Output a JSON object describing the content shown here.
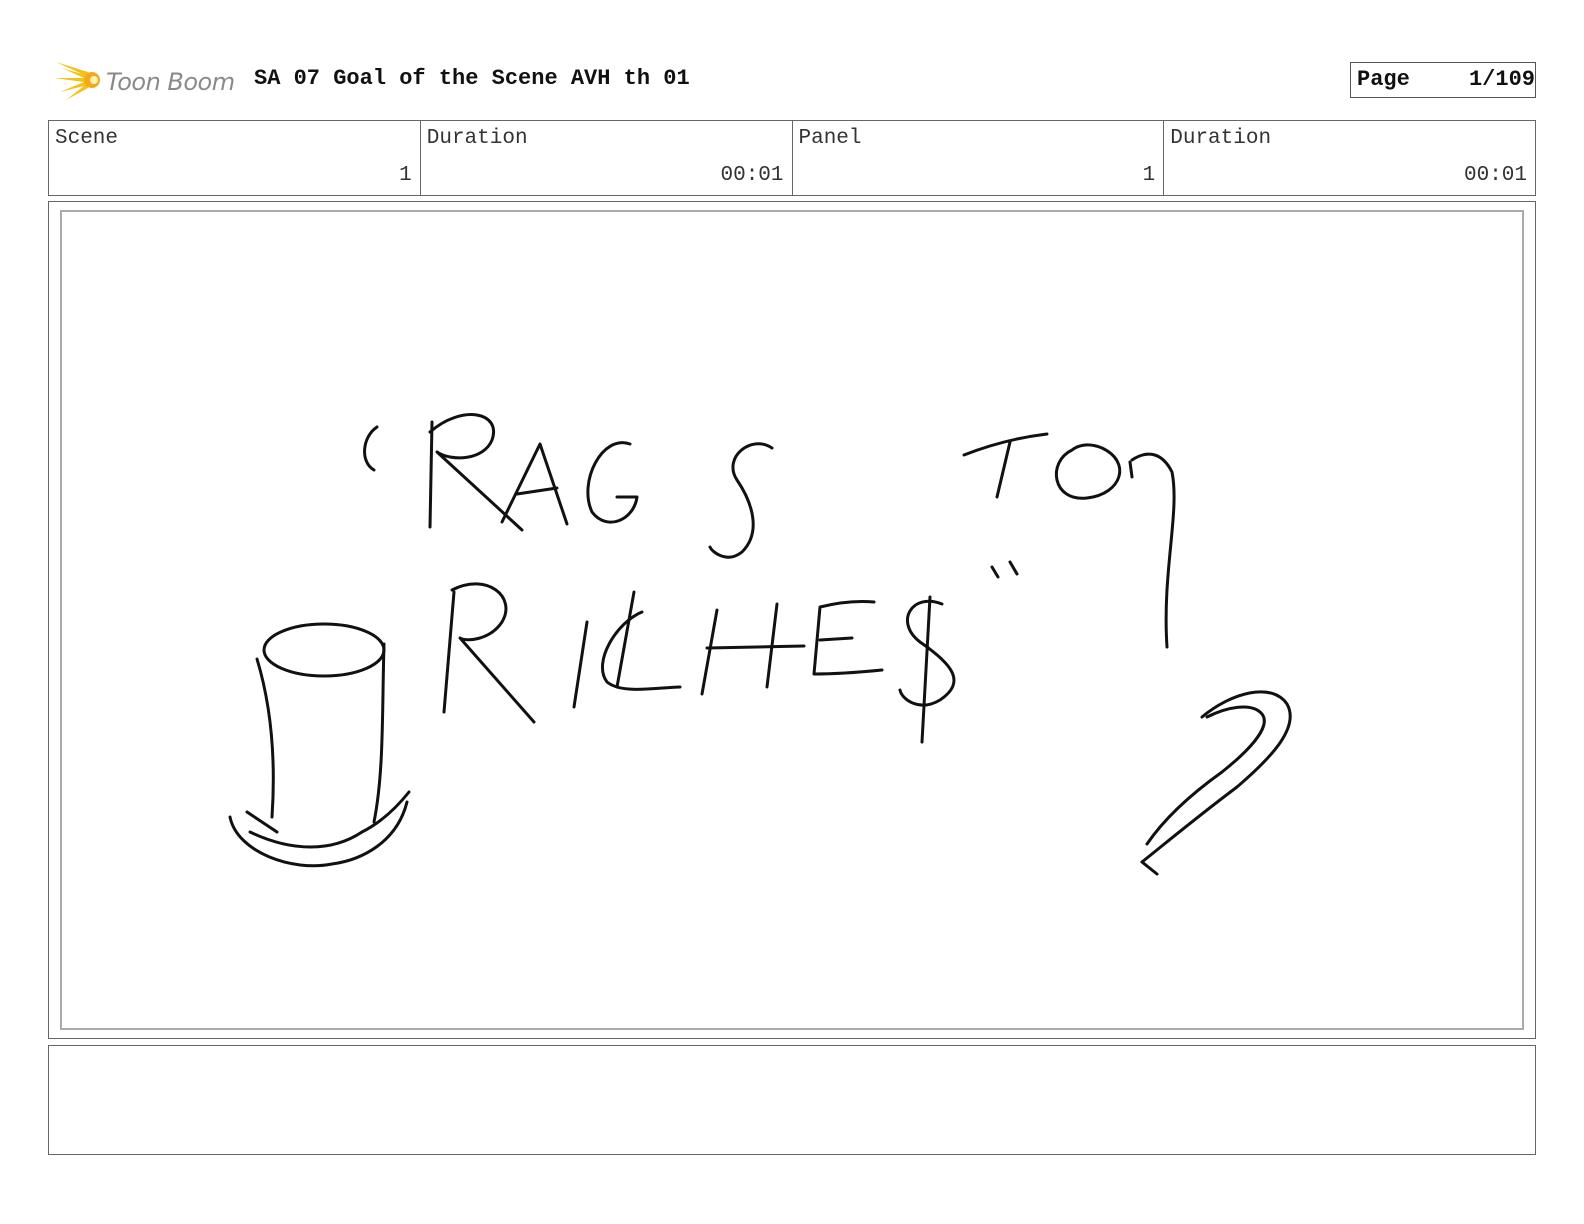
{
  "header": {
    "logo_text": "Toon Boom",
    "title": "SA 07 Goal of the Scene AVH th 01",
    "page_label": "Page",
    "page_number": "1/109"
  },
  "info": [
    {
      "label": "Scene",
      "value": "1"
    },
    {
      "label": "Duration",
      "value": "00:01"
    },
    {
      "label": "Panel",
      "value": "1"
    },
    {
      "label": "Duration",
      "value": "00:01"
    }
  ],
  "panel": {
    "sketch_text": "“RAGS TO RICHES”",
    "sketch_items": [
      "top-hat",
      "cane"
    ]
  },
  "notes": {
    "text": ""
  },
  "colors": {
    "logo_flare": "#f2c21a",
    "border": "#666666"
  }
}
